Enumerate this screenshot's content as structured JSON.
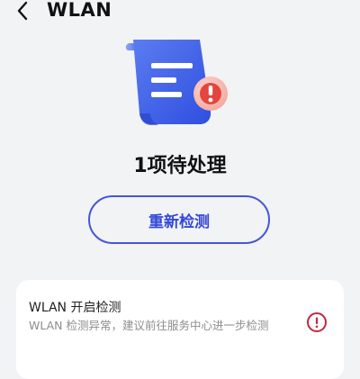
{
  "header": {
    "title": "WLAN",
    "back_icon": "chevron-left-icon"
  },
  "illustration": {
    "icon": "document-warning-icon",
    "document_color": "#3f63e6",
    "badge_color": "#e2463f"
  },
  "status": {
    "pending_text": "1项待处理"
  },
  "actions": {
    "recheck_label": "重新检测",
    "accent_color": "#4556d8"
  },
  "items": [
    {
      "title": "WLAN 开启检测",
      "description": "WLAN 检测异常，建议前往服务中心进一步检测",
      "status_icon": "warning-circle-icon",
      "status_color": "#c2273f"
    }
  ]
}
